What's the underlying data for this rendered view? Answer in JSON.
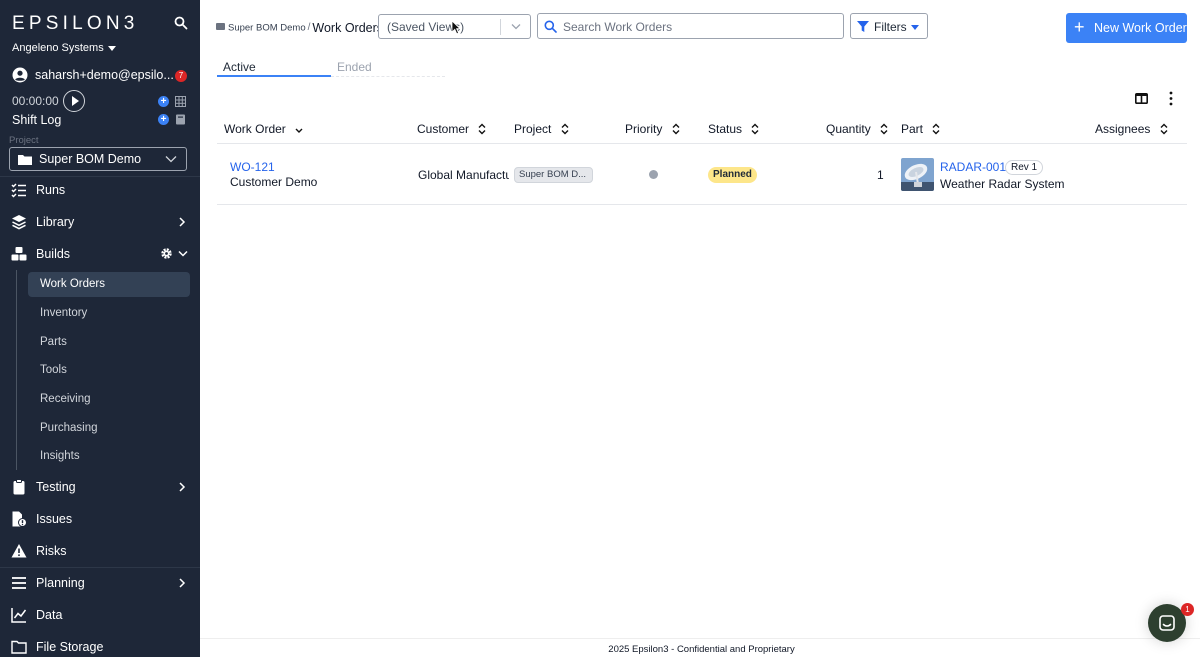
{
  "sidebar": {
    "logo": "EPSILON3",
    "org_name": "Angeleno Systems",
    "user_email": "saharsh+demo@epsilo...",
    "notification_count": "7",
    "timer": "00:00:00",
    "shift_log": "Shift Log",
    "project_label": "Project",
    "project_name": "Super BOM Demo",
    "nav": {
      "runs": "Runs",
      "library": "Library",
      "builds": "Builds",
      "testing": "Testing",
      "issues": "Issues",
      "risks": "Risks",
      "planning": "Planning",
      "data": "Data",
      "file_storage": "File Storage"
    },
    "builds_sub": [
      "Work Orders",
      "Inventory",
      "Parts",
      "Tools",
      "Receiving",
      "Purchasing",
      "Insights"
    ]
  },
  "header": {
    "breadcrumb_parent": "Super BOM Demo",
    "breadcrumb_sep": "/",
    "breadcrumb_current": "Work Orders",
    "saved_views_placeholder": "(Saved Views)",
    "search_placeholder": "Search Work Orders",
    "filters_label": "Filters",
    "new_button_label": "New Work Order",
    "new_button_plus": "+"
  },
  "tabs": {
    "active": "Active",
    "ended": "Ended"
  },
  "table": {
    "columns": [
      "Work Order",
      "Customer",
      "Project",
      "Priority",
      "Status",
      "Quantity",
      "Part",
      "Assignees"
    ],
    "rows": [
      {
        "id": "WO-121",
        "name": "Customer Demo",
        "customer": "Global Manufactu",
        "project": "Super BOM D...",
        "status": "Planned",
        "quantity": "1",
        "part_number": "RADAR-001",
        "part_rev": "Rev 1",
        "part_name": "Weather Radar System"
      }
    ]
  },
  "footer": {
    "text": "2025 Epsilon3 - Confidential and Proprietary"
  },
  "chat": {
    "badge": "1"
  },
  "colors": {
    "sidebar_bg": "#1e2738",
    "accent": "#3b82f6",
    "link": "#2563eb",
    "status_planned": "#fde68a",
    "badge_red": "#dc2626"
  }
}
